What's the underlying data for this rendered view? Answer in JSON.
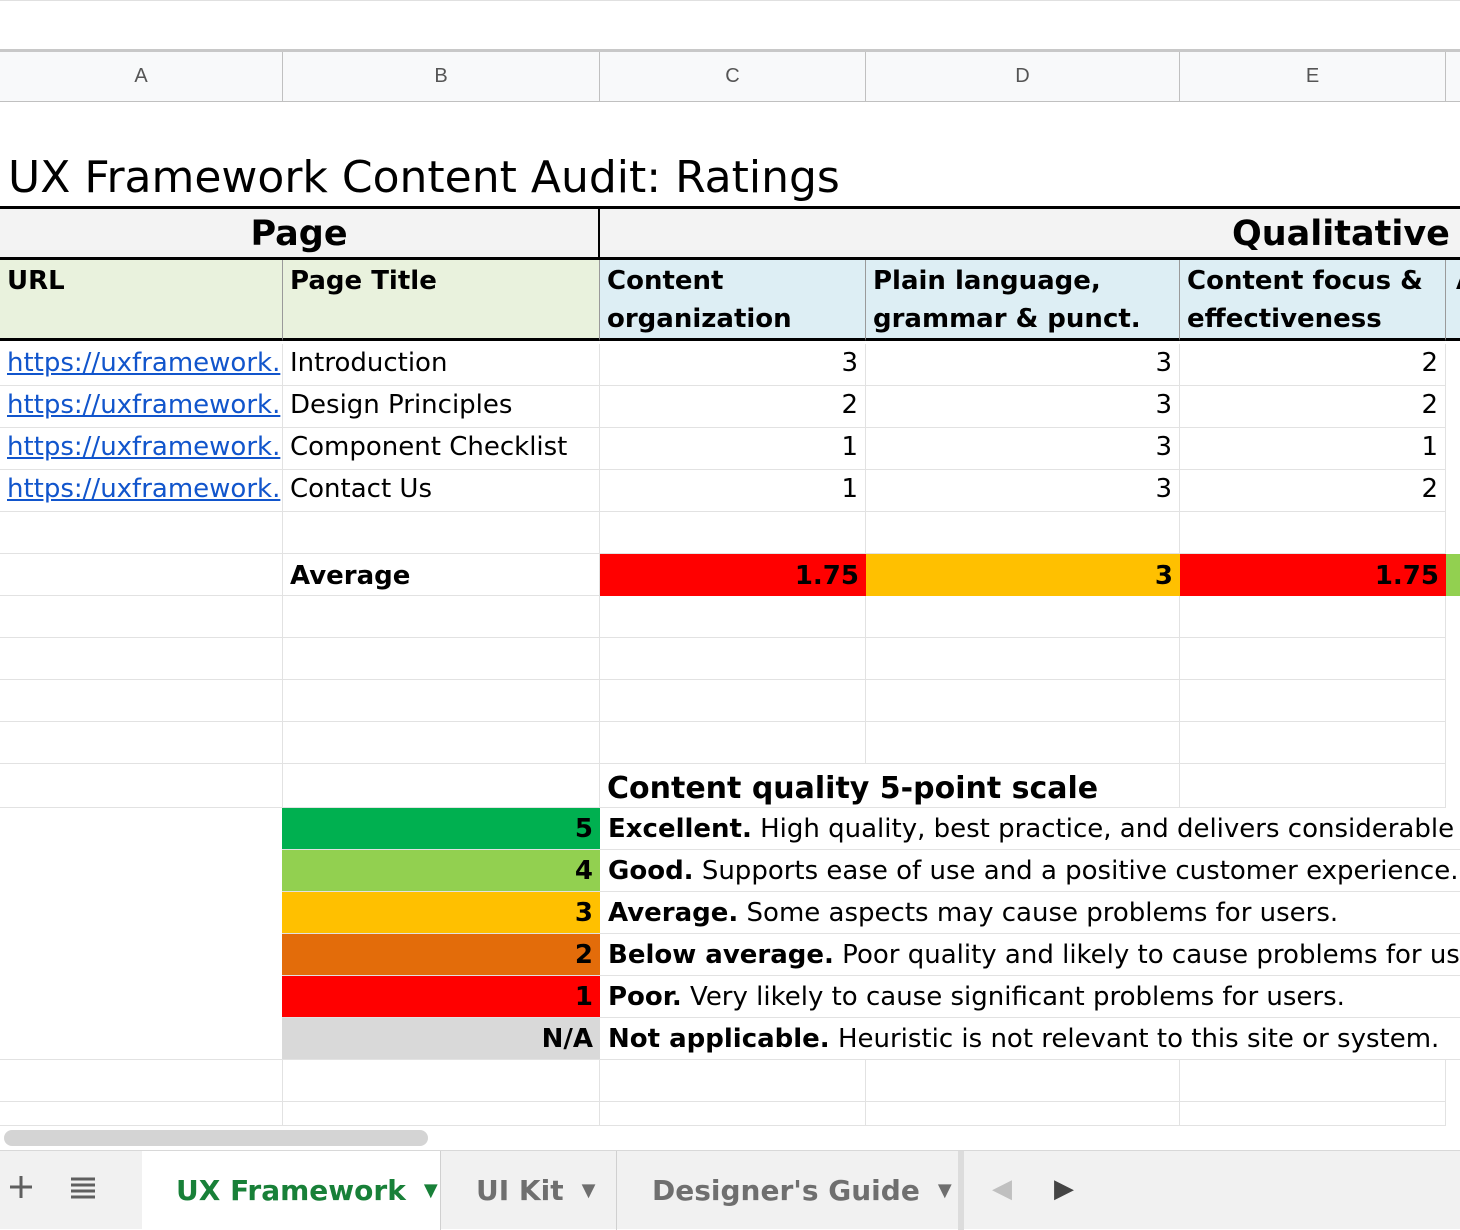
{
  "columns": [
    "A",
    "B",
    "C",
    "D",
    "E"
  ],
  "title": "UX Framework Content Audit: Ratings",
  "bands": {
    "page": "Page",
    "qualitative": "Qualitative Cr"
  },
  "headers": {
    "url": "URL",
    "page_title": "Page Title",
    "content_org_1": "Content",
    "content_org_2": "organization",
    "plain_lang_1": "Plain language,",
    "plain_lang_2": "grammar & punct.",
    "focus_1": "Content focus &",
    "focus_2": "effectiveness",
    "next_col": "A"
  },
  "rows": [
    {
      "url": "https://uxframework.",
      "title": "Introduction",
      "c": "3",
      "d": "3",
      "e": "2"
    },
    {
      "url": "https://uxframework.",
      "title": "Design Principles",
      "c": "2",
      "d": "3",
      "e": "2"
    },
    {
      "url": "https://uxframework.",
      "title": "Component Checklist",
      "c": "1",
      "d": "3",
      "e": "1"
    },
    {
      "url": "https://uxframework.",
      "title": "Contact Us",
      "c": "1",
      "d": "3",
      "e": "2"
    }
  ],
  "average": {
    "label": "Average",
    "c": "1.75",
    "d": "3",
    "e": "1.75",
    "colors": {
      "c": "#ff0000",
      "d": "#ffc000",
      "e": "#ff0000",
      "f": "#92d050"
    }
  },
  "scale": {
    "heading": "Content quality 5-point scale",
    "items": [
      {
        "num": "5",
        "label": "Excellent.",
        "desc": " High quality, best practice, and delivers considerable ben",
        "color": "#00b050"
      },
      {
        "num": "4",
        "label": "Good.",
        "desc": " Supports ease of use and a positive customer experience.",
        "color": "#92d050"
      },
      {
        "num": "3",
        "label": "Average.",
        "desc": " Some aspects may cause problems for users.",
        "color": "#ffc000"
      },
      {
        "num": "2",
        "label": "Below average.",
        "desc": " Poor quality and likely to cause problems for users.",
        "color": "#e36c0a"
      },
      {
        "num": "1",
        "label": "Poor.",
        "desc": " Very likely to cause significant problems for users.",
        "color": "#ff0000"
      },
      {
        "num": "N/A",
        "label": "Not applicable.",
        "desc": " Heuristic is not relevant to this site or system.",
        "color": "#d9d9d9"
      }
    ]
  },
  "tabs": [
    {
      "label": "UX Framework",
      "active": true
    },
    {
      "label": "UI Kit",
      "active": false
    },
    {
      "label": "Designer's Guide",
      "active": false
    }
  ],
  "icons": {
    "add": "add-sheet-icon",
    "menu": "all-sheets-icon",
    "caret": "chevron-down-icon",
    "prev": "scroll-left-icon",
    "next": "scroll-right-icon"
  },
  "accent": "#188038"
}
